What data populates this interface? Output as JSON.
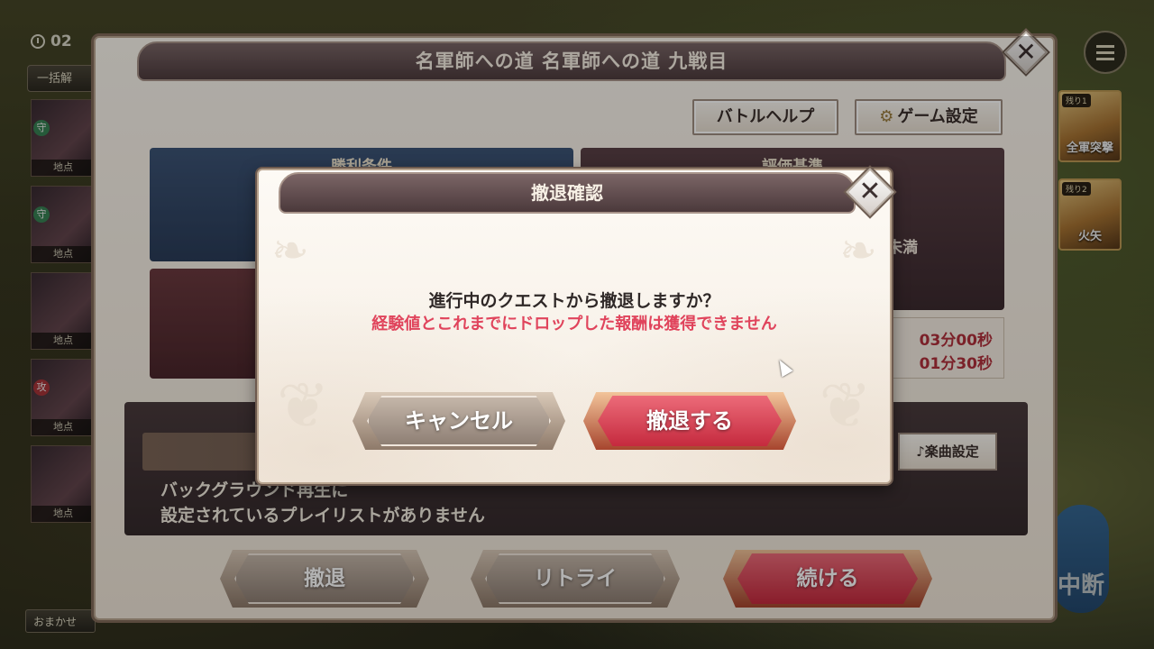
{
  "hud": {
    "timer_value": "02",
    "bulk_release_label": "一括解",
    "unit_tag": "地点",
    "auto_label": "おまかせ",
    "skill1_badge": "残り1",
    "skill1_name": "全軍突撃",
    "skill2_badge": "残り2",
    "skill2_name": "火矢",
    "pause_label": "中断"
  },
  "main_panel": {
    "title": "名軍師への道 名軍師への道 九戦目",
    "battle_help_label": "バトルヘルプ",
    "game_settings_label": "ゲーム設定",
    "victory_header": "勝利条件",
    "evaluation_header": "評価基準",
    "evaluation_text": "未満",
    "time1": "03分00秒",
    "time2": "01分30秒",
    "music_settings_label": "楽曲設定",
    "bgm_message_line1": "バックグラウンド再生に",
    "bgm_message_line2": "設定されているプレイリストがありません",
    "retreat_label": "撤退",
    "retry_label": "リトライ",
    "continue_label": "続ける"
  },
  "dialog": {
    "title": "撤退確認",
    "message": "進行中のクエストから撤退しますか？",
    "warning": "経験値とこれまでにドロップした報酬は獲得できません",
    "cancel_label": "キャンセル",
    "confirm_label": "撤退する"
  },
  "colors": {
    "accent_red": "#c52a3e",
    "warning_text": "#e0445c",
    "title_bar": "#4b393b"
  }
}
